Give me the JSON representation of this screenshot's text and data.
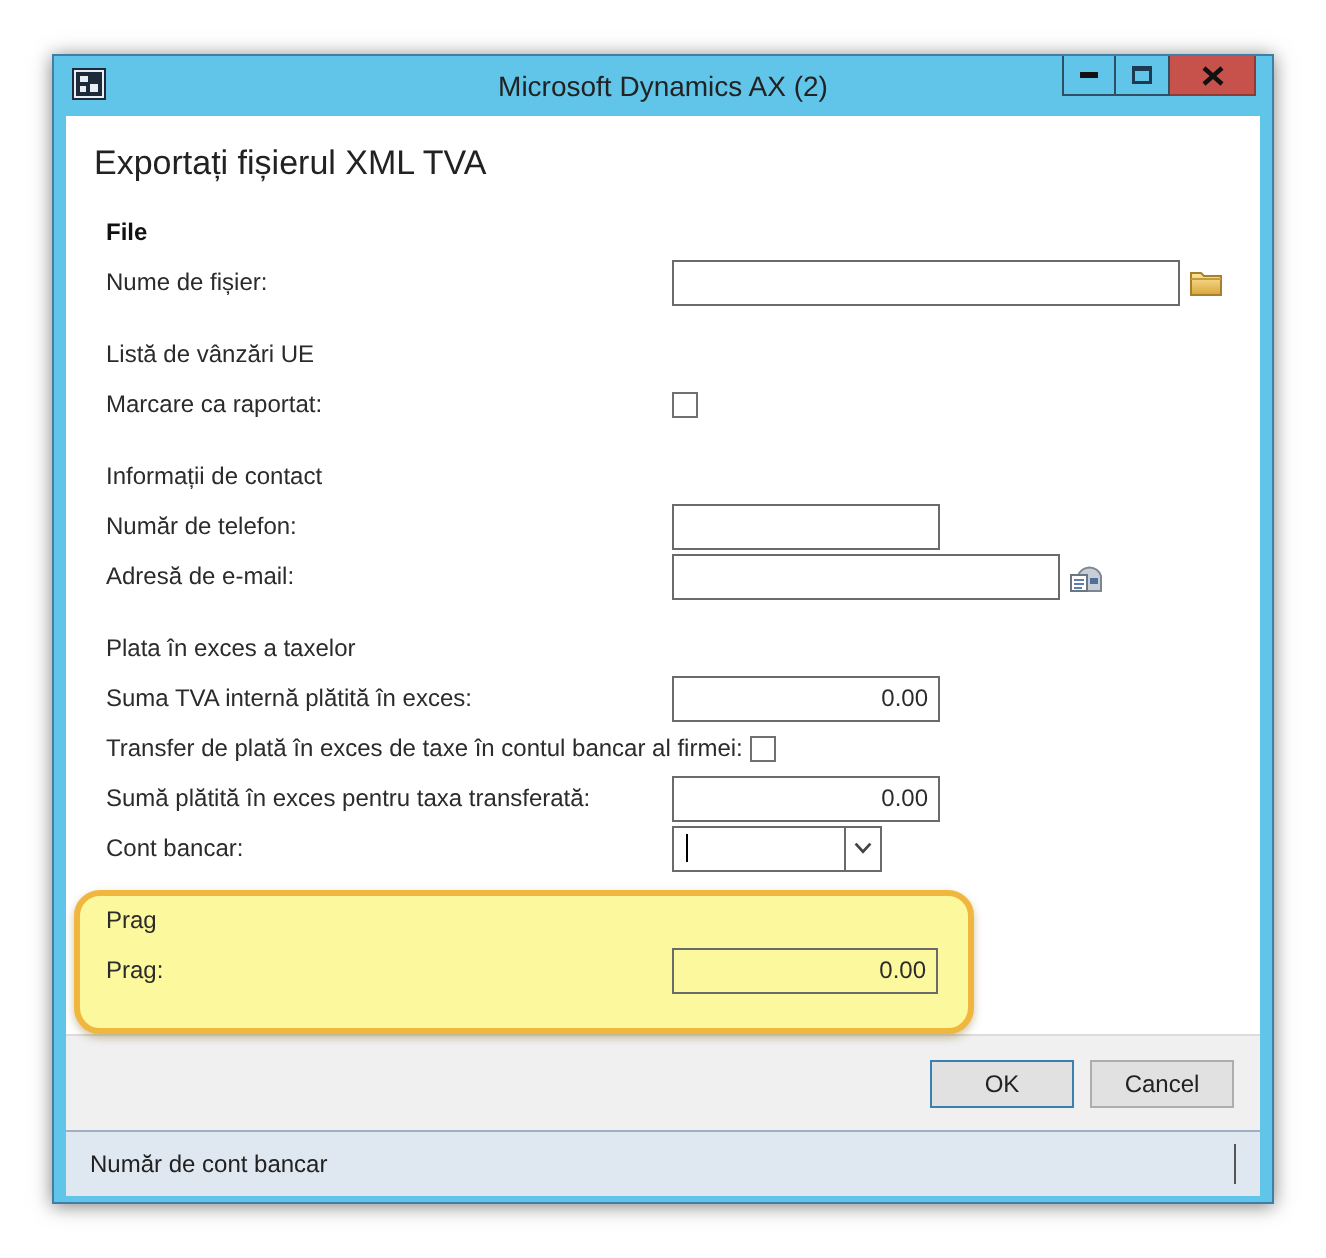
{
  "window": {
    "title": "Microsoft Dynamics AX (2)"
  },
  "dialog": {
    "heading": "Exportați fișierul XML TVA"
  },
  "sections": [
    {
      "title": "File",
      "bold": true,
      "highlighted": false,
      "rows": [
        {
          "kind": "file",
          "label": "Nume de fișier:"
        }
      ]
    },
    {
      "title": "Listă de vânzări UE",
      "bold": false,
      "highlighted": false,
      "rows": [
        {
          "kind": "checkbox",
          "label": "Marcare ca raportat:",
          "checked": false
        }
      ]
    },
    {
      "title": "Informații de contact",
      "bold": false,
      "highlighted": false,
      "rows": [
        {
          "kind": "text",
          "label": "Număr de telefon:"
        },
        {
          "kind": "email",
          "label": "Adresă de e-mail:"
        }
      ]
    },
    {
      "title": "Plata în exces a taxelor",
      "bold": false,
      "highlighted": false,
      "rows": [
        {
          "kind": "amount",
          "label": "Suma TVA internă plătită în exces:",
          "value": "0.00"
        },
        {
          "kind": "checkbox",
          "label": "Transfer de plată în exces de taxe în contul bancar al firmei:",
          "checked": false
        },
        {
          "kind": "amount",
          "label": "Sumă plătită în exces pentru taxa transferată:",
          "value": "0.00"
        },
        {
          "kind": "combo",
          "label": "Cont bancar:",
          "focused": true
        }
      ]
    },
    {
      "title": "Prag",
      "bold": false,
      "highlighted": true,
      "rows": [
        {
          "kind": "amount",
          "label": "Prag:",
          "value": "0.00"
        }
      ]
    }
  ],
  "buttons": [
    {
      "label": "OK",
      "default": true
    },
    {
      "label": "Cancel",
      "default": false
    }
  ],
  "status_bar": {
    "text": "Număr de cont bancar"
  }
}
